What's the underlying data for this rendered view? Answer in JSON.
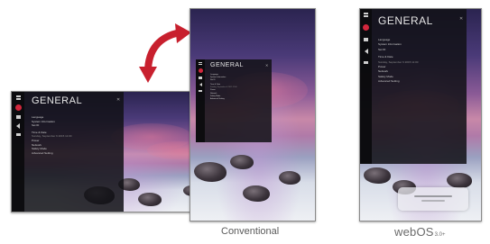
{
  "settings": {
    "title": "GENERAL",
    "rail": [
      "",
      ""
    ],
    "menu": [
      "Language",
      "System Information",
      "Set ID",
      "Time & Date",
      "Sunday, September 6 2015 11:00",
      "Power",
      "Network",
      "Safety Mode",
      "Advanced Setting"
    ]
  },
  "captions": {
    "conventional": "Conventional",
    "webos_main": "webOS",
    "webos_version": "3.0+"
  },
  "colors": {
    "accent": "#d2273d",
    "arrow": "#c8202e"
  },
  "icons": {
    "swap": "curved-double-arrow-icon"
  }
}
